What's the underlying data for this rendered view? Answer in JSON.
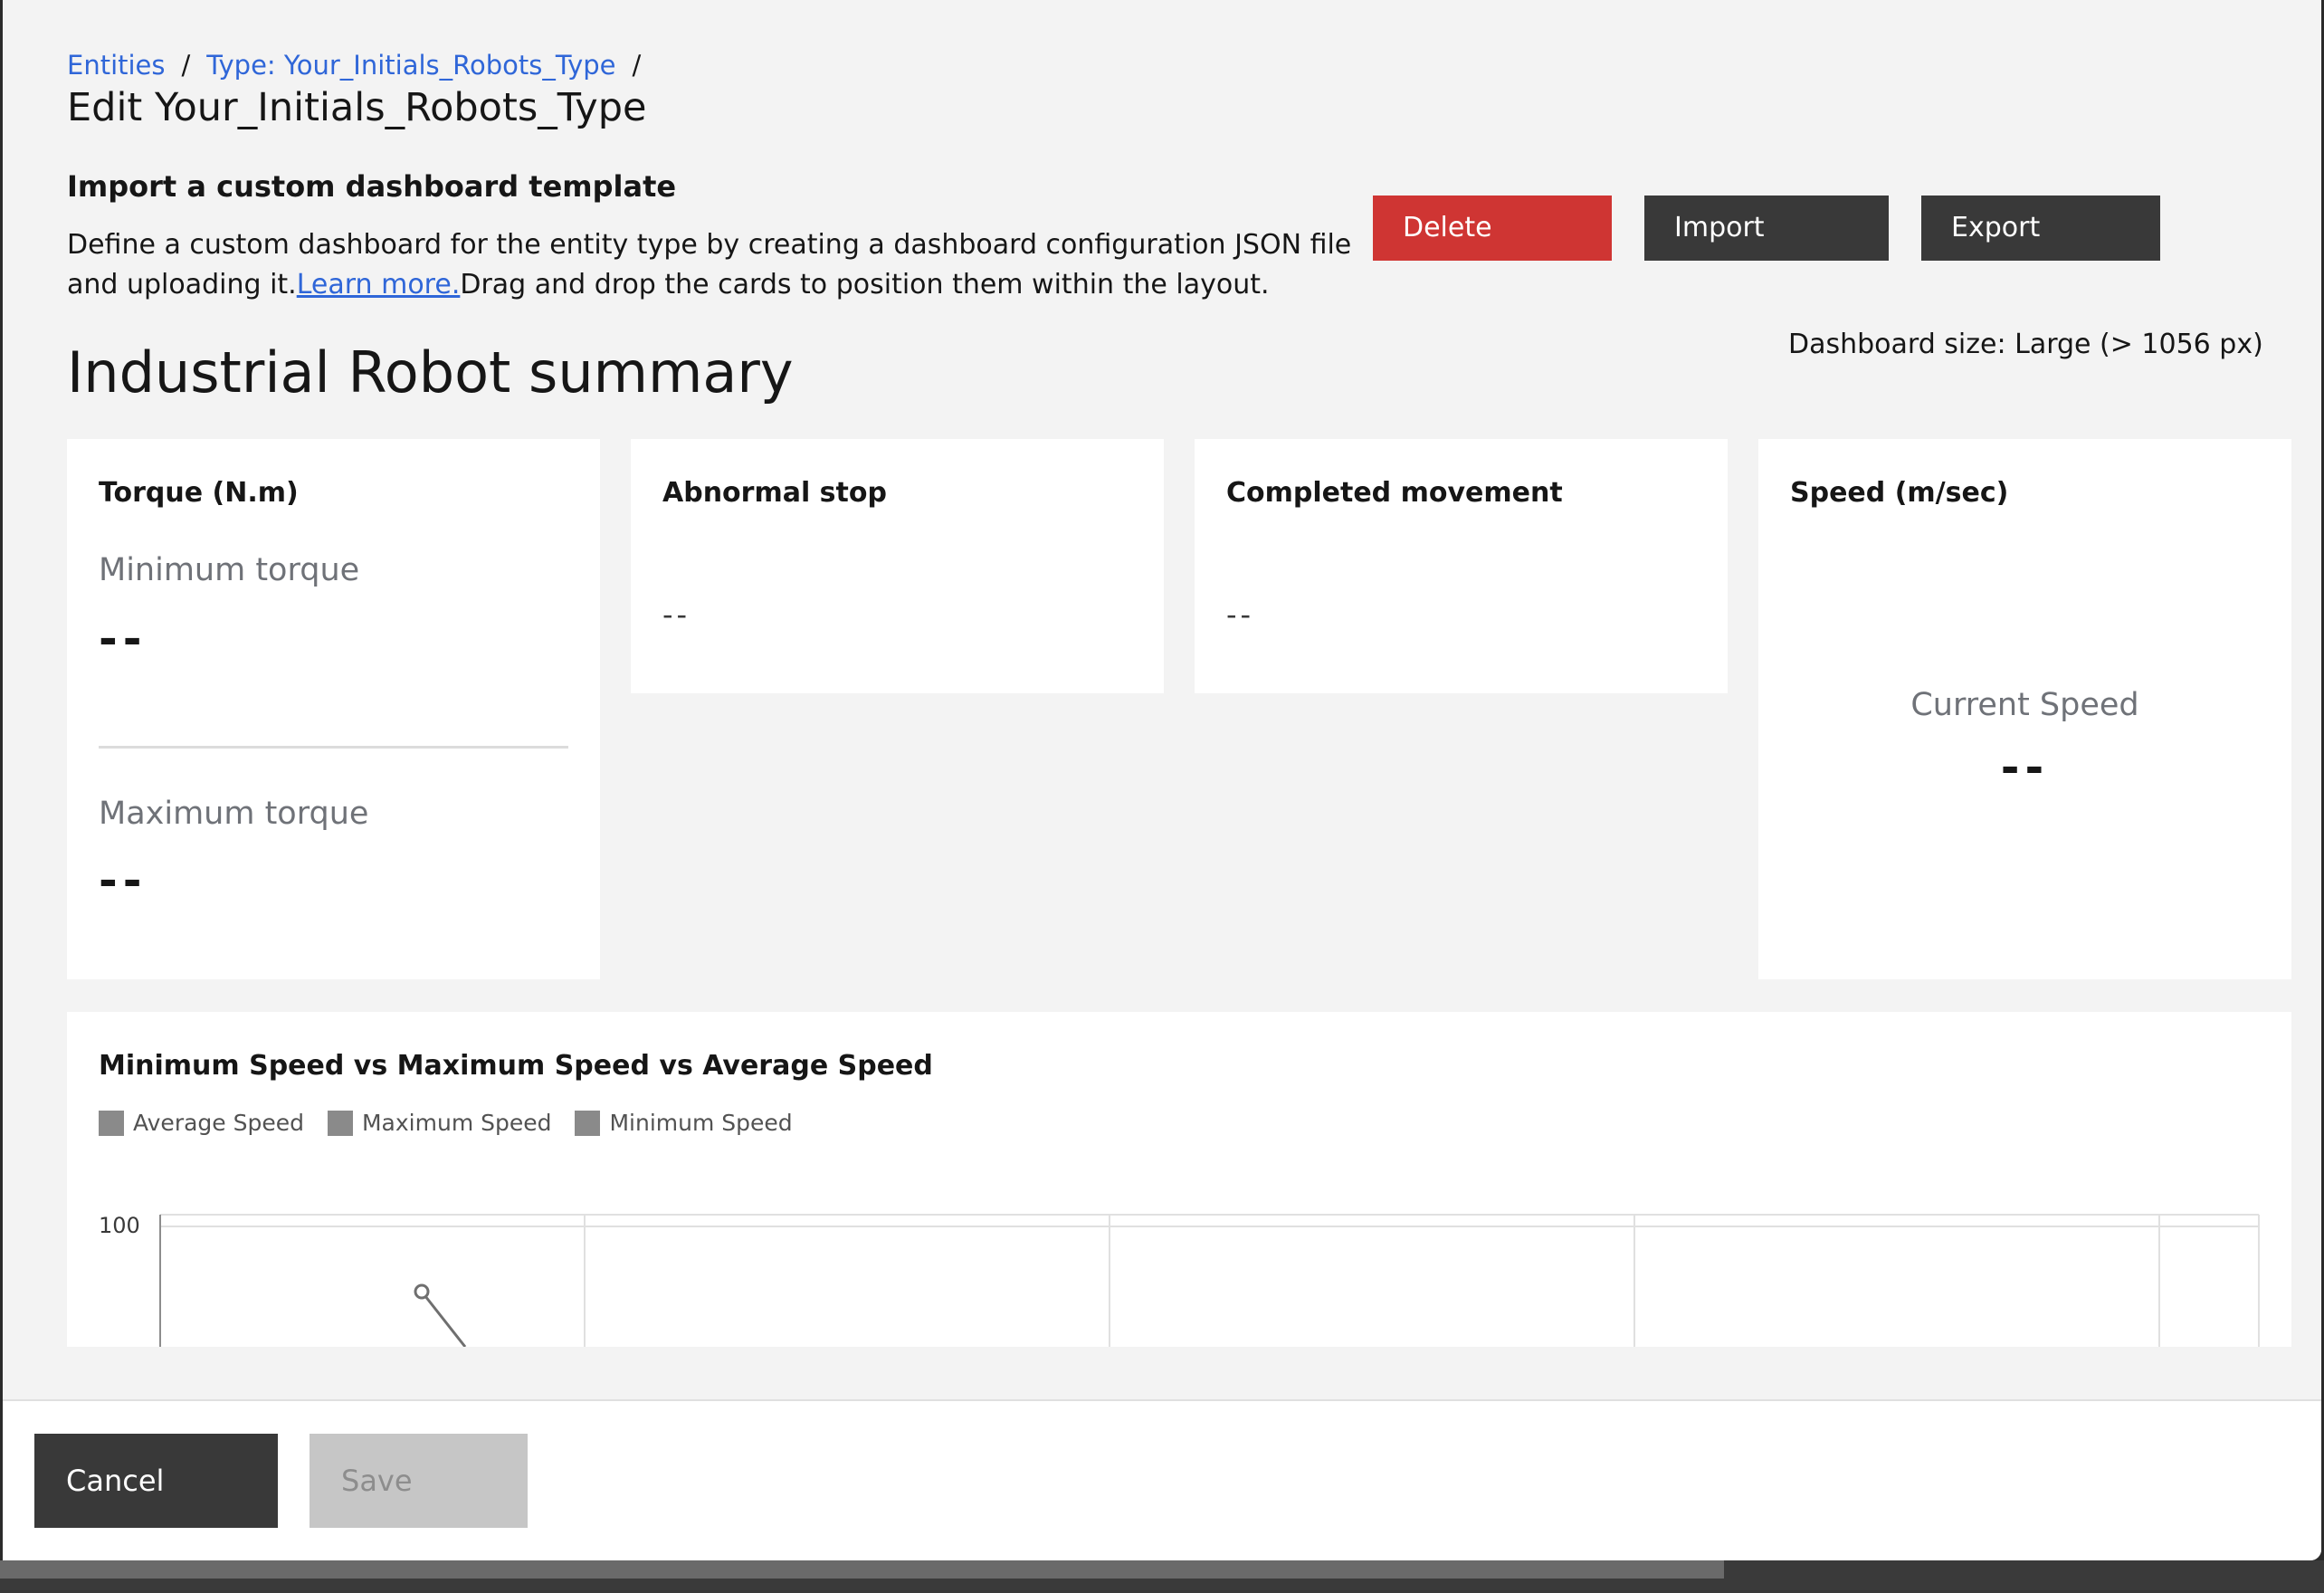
{
  "breadcrumb": {
    "items": [
      "Entities",
      "Type: Your_Initials_Robots_Type"
    ],
    "separator": "/"
  },
  "page_title": "Edit Your_Initials_Robots_Type",
  "import_section": {
    "heading": "Import a custom dashboard template",
    "description_before": "Define a custom dashboard for the entity type by creating a dashboard configuration JSON file and uploading it.",
    "learn_more": "Learn more.",
    "description_after": "Drag and drop the cards to position them within the layout."
  },
  "actions": {
    "delete_label": "Delete",
    "import_label": "Import",
    "export_label": "Export"
  },
  "dashboard": {
    "size_label": "Dashboard size: Large (> 1056 px)",
    "title": "Industrial Robot summary",
    "cards": {
      "torque": {
        "title": "Torque (N.m)",
        "min_label": "Minimum torque",
        "min_value": "--",
        "max_label": "Maximum torque",
        "max_value": "--"
      },
      "abnormal_stop": {
        "title": "Abnormal stop",
        "value": "--"
      },
      "completed_movement": {
        "title": "Completed movement",
        "value": "--"
      },
      "speed": {
        "title": "Speed (m/sec)",
        "label": "Current Speed",
        "value": "--"
      }
    },
    "chart_card": {
      "title": "Minimum Speed vs Maximum Speed vs Average Speed",
      "legend": [
        "Average Speed",
        "Maximum Speed",
        "Minimum Speed"
      ],
      "y_tick_label": "100"
    }
  },
  "chart_data": {
    "type": "line",
    "title": "Minimum Speed vs Maximum Speed vs Average Speed",
    "series": [
      {
        "name": "Average Speed",
        "values": []
      },
      {
        "name": "Maximum Speed",
        "values": []
      },
      {
        "name": "Minimum Speed",
        "values": []
      }
    ],
    "y_ticks": [
      100
    ],
    "legend_position": "top-left",
    "grid": true,
    "colors": {
      "series": "#8a8a8a",
      "grid": "#e0e0e0",
      "axis": "#8d8d8d"
    }
  },
  "footer": {
    "cancel_label": "Cancel",
    "save_label": "Save"
  },
  "colors": {
    "danger": "#cf3533",
    "button_dark": "#393939",
    "link": "#2f66d8",
    "disabled": "#c6c6c6"
  }
}
